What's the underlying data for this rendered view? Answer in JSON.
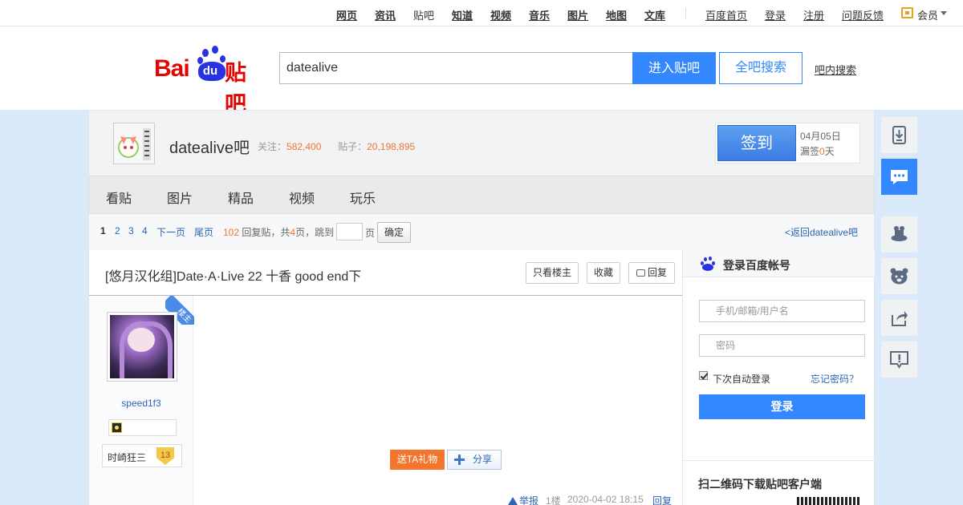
{
  "topnav": {
    "items": [
      {
        "label": "网页"
      },
      {
        "label": "资讯"
      },
      {
        "label": "贴吧"
      },
      {
        "label": "知道"
      },
      {
        "label": "视频"
      },
      {
        "label": "音乐"
      },
      {
        "label": "图片"
      },
      {
        "label": "地图"
      },
      {
        "label": "文库"
      }
    ],
    "right": [
      {
        "label": "百度首页"
      },
      {
        "label": "登录"
      },
      {
        "label": "注册"
      },
      {
        "label": "问题反馈"
      }
    ],
    "member": "会员"
  },
  "header": {
    "logo_bai": "Bai",
    "logo_du": "du",
    "logo_tieba": "贴吧",
    "search_value": "datealive",
    "enter_label": "进入贴吧",
    "all_search_label": "全吧搜索",
    "inbar_search_label": "吧内搜索"
  },
  "forum": {
    "name": "datealive吧",
    "follow_label": "关注：",
    "follow_count": "582,400",
    "posts_label": "贴子：",
    "posts_count": "20,198,895",
    "sign_label": "签到",
    "sign_date": "04月05日",
    "miss_prefix": "漏签",
    "miss_count": "0",
    "miss_suffix": "天"
  },
  "tabs": [
    "看贴",
    "图片",
    "精品",
    "视频",
    "玩乐"
  ],
  "pager": {
    "pages": [
      "1",
      "2",
      "3",
      "4"
    ],
    "next": "下一页",
    "last": "尾页",
    "reply_count": "102",
    "reply_label": "回复贴，共",
    "page_total": "4",
    "jump_label": "页，跳到",
    "page_unit": "页",
    "confirm": "确定",
    "back": "<返回datealive吧"
  },
  "post": {
    "title": "[悠月汉化组]Date·A·Live 22 十香 good end下",
    "only_owner": "只看楼主",
    "collect": "收藏",
    "reply": "回复",
    "owner_badge": "楼主",
    "username": "speed1f3",
    "rank_name": "时崎狂三",
    "rank_level": "13",
    "gift": "送TA礼物",
    "share": "分享",
    "report": "举报",
    "floor": "1楼",
    "time": "2020-04-02 18:15",
    "reply_link": "回复"
  },
  "login": {
    "title": "登录百度帐号",
    "user_placeholder": "手机/邮箱/用户名",
    "pwd_placeholder": "密码",
    "remember": "下次自动登录",
    "forgot": "忘记密码？",
    "submit": "登录",
    "qr_title": "扫二维码下载贴吧客户端"
  },
  "colors": {
    "brand_blue": "#3388ff",
    "accent_orange": "#f4752d",
    "logo_red": "#e10602",
    "link_blue": "#2d64b3"
  },
  "right_toolbar": [
    "download-icon",
    "message-icon",
    "magic-hat-icon",
    "bear-icon",
    "share-icon",
    "feedback-icon"
  ]
}
